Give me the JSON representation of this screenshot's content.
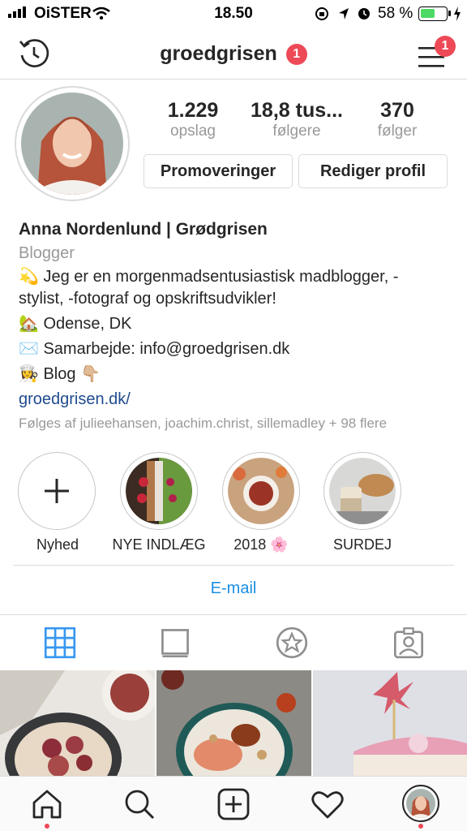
{
  "status_bar": {
    "carrier": "OiSTER",
    "time": "18.50",
    "battery_percent": "58 %",
    "battery_level": 0.58,
    "icons": [
      "signal-icon",
      "wifi-icon",
      "rotation-lock-icon",
      "location-icon",
      "alarm-icon",
      "battery-icon",
      "charging-icon"
    ]
  },
  "nav": {
    "username": "groedgrisen",
    "username_badge": "1",
    "menu_badge": "1",
    "icons": [
      "history-icon",
      "menu-icon"
    ]
  },
  "profile": {
    "stats": [
      {
        "value": "1.229",
        "label": "opslag"
      },
      {
        "value": "18,8 tus...",
        "label": "følgere"
      },
      {
        "value": "370",
        "label": "følger"
      }
    ],
    "promote_label": "Promoveringer",
    "edit_label": "Rediger profil",
    "name": "Anna Nordenlund | Grødgrisen",
    "category": "Blogger",
    "bio_line1": "💫 Jeg er en morgenmadsentusiastisk madblogger, -",
    "bio_line2": "stylist, -fotograf og opskriftsudvikler!",
    "bio_line3": "🏡 Odense, DK",
    "bio_line4": "✉️ Samarbejde: info@groedgrisen.dk",
    "bio_line5": "👩‍🍳 Blog 👇🏼",
    "website": "groedgrisen.dk/",
    "followed_by": "Følges af julieehansen, joachim.christ, sillemadley + 98 flere"
  },
  "highlights": [
    {
      "label": "Nyhed"
    },
    {
      "label": "NYE INDLÆG"
    },
    {
      "label": "2018 🌸"
    },
    {
      "label": "SURDEJ"
    }
  ],
  "contact": {
    "email_label": "E-mail"
  },
  "tabs": [
    "grid-icon",
    "igtv-icon",
    "star-icon",
    "tagged-icon"
  ],
  "bottom_bar": [
    "home-icon",
    "search-icon",
    "add-icon",
    "heart-icon",
    "profile-icon"
  ],
  "colors": {
    "accent": "#3897f0",
    "link": "#1a8fe3",
    "badge": "#ed4956",
    "muted": "#999999"
  }
}
